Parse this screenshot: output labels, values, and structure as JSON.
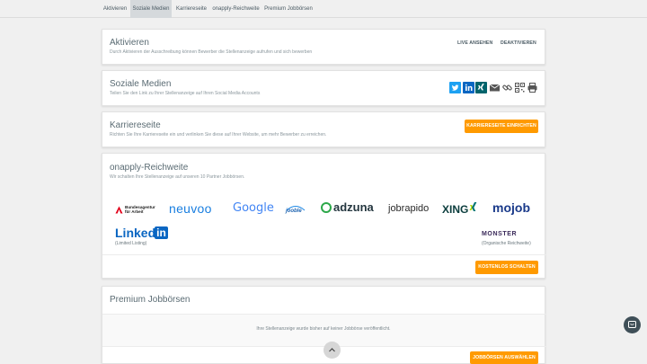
{
  "tabs": [
    {
      "label": "Aktivieren"
    },
    {
      "label": "Soziale Medien"
    },
    {
      "label": "Karriereseite"
    },
    {
      "label": "onapply-Reichweite"
    },
    {
      "label": "Premium Jobbörsen"
    }
  ],
  "activate": {
    "title": "Aktivieren",
    "subtitle": "Durch Aktivieren der Ausschreibung können Bewerber die Stellenanzeige aufrufen und sich bewerben",
    "live_label": "LIVE ANSEHEN",
    "deactivate_label": "DEAKTIVIEREN"
  },
  "social": {
    "title": "Soziale Medien",
    "subtitle": "Teilen Sie den Link zu Ihrer Stellenanzeige auf Ihren Social Media Accounts",
    "icons": [
      "twitter-icon",
      "linkedin-icon",
      "xing-icon",
      "email-icon",
      "link-icon",
      "qr-code-icon",
      "print-icon"
    ],
    "colors": {
      "twitter": "#1da1f2",
      "linkedin": "#0a66c2",
      "xing": "#02646c"
    }
  },
  "career": {
    "title": "Karriereseite",
    "subtitle": "Richten Sie Ihre Karriereseite ein und verlinken Sie diese auf Ihrer Website, um mehr Bewerber zu erreichen.",
    "button_label": "KARRIERESEITE EINRICHTEN"
  },
  "reach": {
    "title": "onapply-Reichweite",
    "subtitle": "Wir schalten Ihre Stellenanzeige auf unseren 10 Partner Jobbörsen.",
    "logos": {
      "ba_line1": "Bundesagentur",
      "ba_line2": "für Arbeit",
      "neuvoo": "neuvoo",
      "google": "Google",
      "joblift": "jooble",
      "adzuna": "adzuna",
      "jobrapido": "jobrapido",
      "xing": "XING",
      "mojob": "mojob",
      "linkedin": "Linked",
      "linkedin_in": "in",
      "linkedin_note": "(Limited Listing)",
      "monster": "MONSTER",
      "monster_note": "(Organische Reichweite)"
    },
    "button_label": "KOSTENLOS SCHALTEN"
  },
  "premium": {
    "title": "Premium Jobbörsen",
    "empty_text": "Ihre Stellenanzeige wurde bisher auf keiner Jobbörse veröffentlicht.",
    "button_label": "JOBBÖRSEN AUSWÄHLEN"
  },
  "colors": {
    "accent": "#ff9a00",
    "active_tab": "#d5d9dc"
  }
}
